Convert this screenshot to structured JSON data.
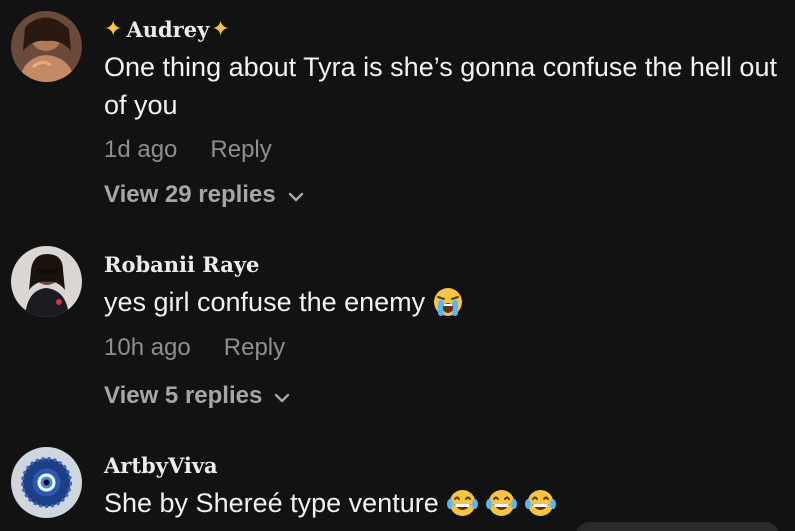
{
  "comments": [
    {
      "username": "Audrey",
      "username_decor": "✨",
      "text": "One thing about Tyra is she’s gonna confuse the hell out of you",
      "time": "1d ago",
      "reply_label": "Reply",
      "view_replies": "View 29 replies"
    },
    {
      "username": "Robanii Raye",
      "text": "yes girl confuse the enemy",
      "time": "10h ago",
      "reply_label": "Reply",
      "view_replies": "View 5 replies"
    },
    {
      "username": "ArtbyViva",
      "text": "She by Shereé type venture"
    }
  ],
  "colors": {
    "background": "#121212",
    "primary_text": "#f2f2f3",
    "secondary_text": "#8e8e93",
    "view_replies_text": "#a6a6aa"
  },
  "icons": {
    "sparkle": "sparkles-emoji",
    "crying": "loudly-crying-emoji",
    "laughing": "tears-of-joy-emoji",
    "chevron": "chevron-down-icon"
  }
}
